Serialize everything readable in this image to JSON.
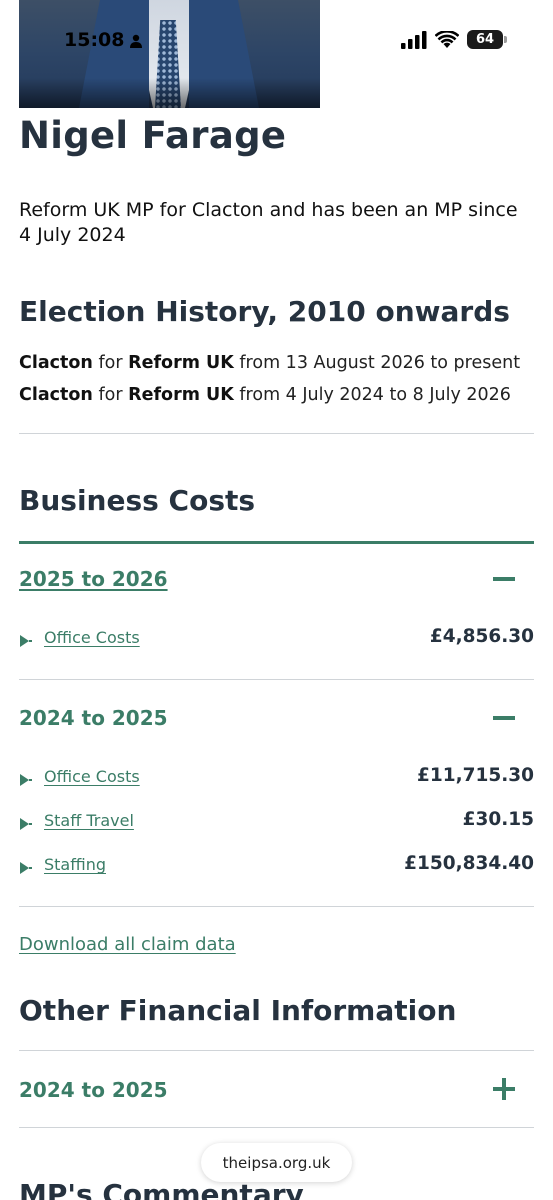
{
  "status_bar": {
    "time": "15:08",
    "battery": "64"
  },
  "profile": {
    "name": "Nigel Farage",
    "subtitle": "Reform UK MP for Clacton and has been an MP since 4 July 2024"
  },
  "election_history": {
    "heading": "Election History, 2010 onwards",
    "rows": [
      {
        "constituency": "Clacton",
        "for": "for",
        "party": "Reform UK",
        "period": "from 13 August 2026 to present"
      },
      {
        "constituency": "Clacton",
        "for": "for",
        "party": "Reform UK",
        "period": "from 4 July 2024 to 8 July 2026"
      }
    ]
  },
  "business_costs": {
    "heading": "Business Costs",
    "years": [
      {
        "label": "2025 to 2026",
        "expanded": true,
        "items": [
          {
            "label": "Office Costs",
            "amount": "£4,856.30"
          }
        ]
      },
      {
        "label": "2024 to 2025",
        "expanded": true,
        "items": [
          {
            "label": "Office Costs",
            "amount": "£11,715.30"
          },
          {
            "label": "Staff Travel",
            "amount": "£30.15"
          },
          {
            "label": "Staffing",
            "amount": "£150,834.40"
          }
        ]
      }
    ],
    "download_label": "Download all claim data"
  },
  "other_financial": {
    "heading": "Other Financial Information",
    "years": [
      {
        "label": "2024 to 2025",
        "expanded": false
      }
    ]
  },
  "commentary": {
    "heading": "MP's Commentary"
  },
  "browser": {
    "url": "theipsa.org.uk"
  },
  "colors": {
    "accent": "#3b7d67",
    "heading": "#26323f"
  }
}
